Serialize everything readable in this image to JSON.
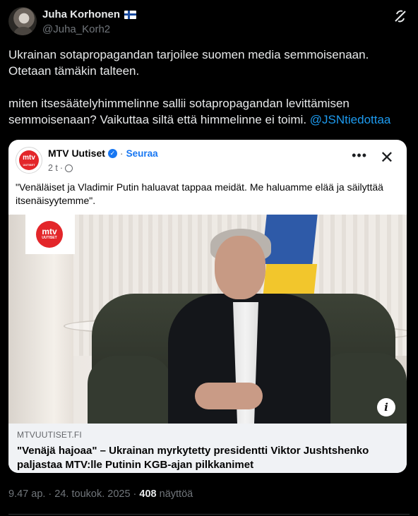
{
  "author": {
    "display_name": "Juha Korhonen",
    "handle": "@Juha_Korh2",
    "flag_icon": "finland-flag-icon"
  },
  "tweet": {
    "paragraphs": [
      "Ukrainan sotapropagandan tarjoilee suomen media semmoisenaan. Otetaan tämäkin talteen.",
      "miten itsesäätelyhimmelinne sallii sotapropagandan levittämisen semmoisenaan? Vaikuttaa siltä että himmelinne ei toimi."
    ],
    "mention": "@JSNtiedottaa"
  },
  "embedded_post": {
    "page_name": "MTV Uutiset",
    "follow_label": "Seuraa",
    "time": "2 t",
    "text": "\"Venäläiset ja Vladimir Putin haluavat tappaa meidät. Me haluamme elää ja säilyttää itsenäisyytemme\".",
    "logo_text": "mtv",
    "logo_subtext": "UUTISET",
    "link_domain": "MTVUUTISET.FI",
    "link_title": "\"Venäjä hajoaa\" – Ukrainan myrkytetty presidentti Viktor Jushtshenko paljastaa MTV:lle Putinin KGB-ajan pilkkanimet"
  },
  "meta": {
    "time_date": "9.47 ap. · 24. toukok. 2025 ·",
    "views_count": "408",
    "views_label": "näyttöä"
  },
  "colors": {
    "background": "#000000",
    "text": "#e7e9ea",
    "muted": "#71767b",
    "link": "#1d9bf0",
    "mtv_red": "#e3262a",
    "fb_blue": "#1877f2"
  }
}
